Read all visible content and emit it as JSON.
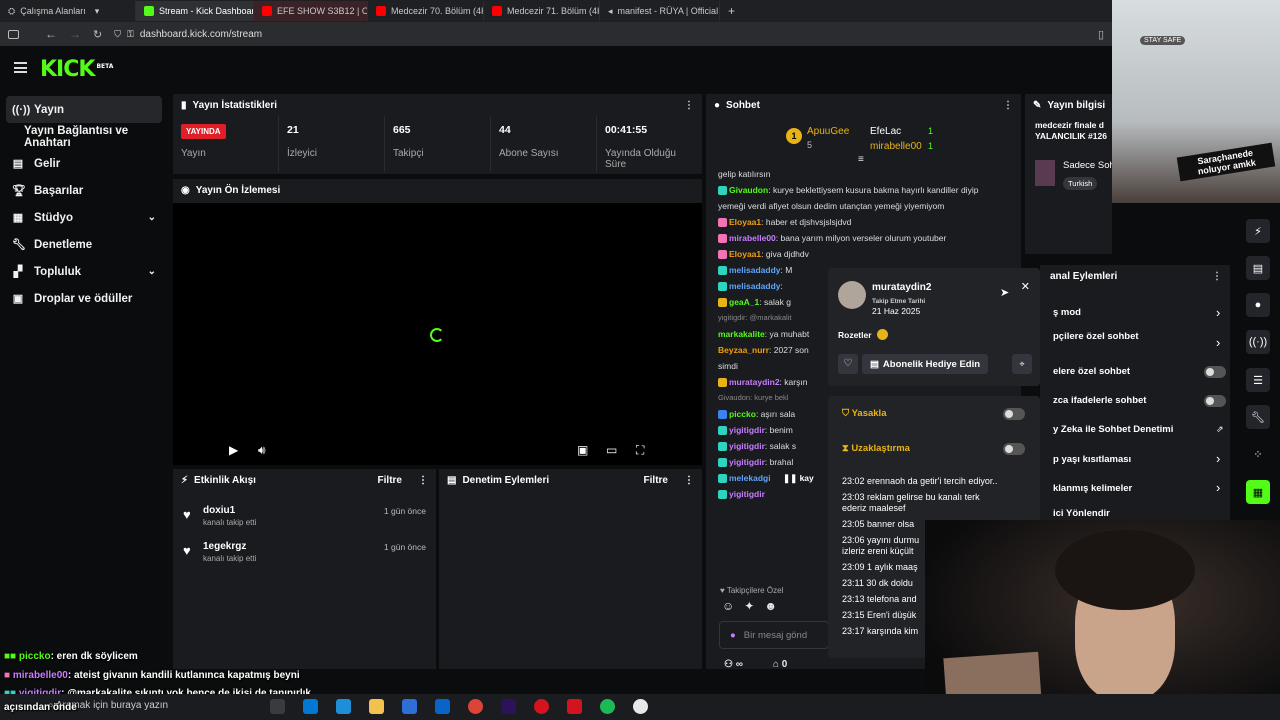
{
  "browser": {
    "tabs": [
      {
        "label": "Çalışma Alanları"
      },
      {
        "label": "Stream - Kick Dashboard"
      },
      {
        "label": "EFE SHOW S3B12 | ORKUN"
      },
      {
        "label": "Medcezir 70. Bölüm (4K) -"
      },
      {
        "label": "Medcezir 71. Bölüm (4K) -"
      },
      {
        "label": "manifest - RÜYA | Official M"
      }
    ],
    "new_tab": "+",
    "url": "dashboard.kick.com/stream"
  },
  "kick": {
    "logo": "KICK",
    "logo_badge": "BETA",
    "sidebar": [
      {
        "label": "Yayın",
        "icon": "broadcast-icon"
      },
      {
        "label": "Yayın Bağlantısı ve Anahtarı",
        "icon": ""
      },
      {
        "label": "Gelir",
        "icon": "revenue-icon"
      },
      {
        "label": "Başarılar",
        "icon": "trophy-icon"
      },
      {
        "label": "Stüdyo",
        "icon": "studio-icon"
      },
      {
        "label": "Denetleme",
        "icon": "wrench-icon"
      },
      {
        "label": "Topluluk",
        "icon": "community-icon"
      },
      {
        "label": "Droplar ve ödüller",
        "icon": "drops-icon"
      }
    ],
    "stats_panel": {
      "title": "Yayın İstatistikleri",
      "live_badge": "YAYINDA",
      "live_label": "Yayın",
      "items": [
        {
          "value": "21",
          "label": "İzleyici"
        },
        {
          "value": "665",
          "label": "Takipçi"
        },
        {
          "value": "44",
          "label": "Abone Sayısı"
        },
        {
          "value": "00:41:55",
          "label": "Yayında Olduğu Süre"
        }
      ]
    },
    "preview_title": "Yayın Ön İzlemesi",
    "activity": {
      "title": "Etkinlik Akışı",
      "filter": "Filtre",
      "items": [
        {
          "user": "doxiu1",
          "action": "kanalı takip etti",
          "time": "1 gün önce"
        },
        {
          "user": "1egekrgz",
          "action": "kanalı takip etti",
          "time": "1 gün önce"
        }
      ]
    },
    "mod_actions": {
      "title": "Denetim Eylemleri",
      "filter": "Filtre"
    },
    "chat": {
      "title": "Sohbet",
      "top_gifters": [
        {
          "name": "ApuuGee",
          "count": "5"
        },
        {
          "name": "EfeLac",
          "count": "1"
        },
        {
          "name": "mirabelle00",
          "count": "1"
        }
      ],
      "messages": [
        {
          "user": "",
          "text": "gelip katılırsın"
        },
        {
          "user": "Givaudon",
          "text": "kurye beklettiysem kusura bakma hayırlı kandiller diyip"
        },
        {
          "user": "",
          "text": "yemeği verdi afiyet olsun dedim utançtan yemeği yiyemiyom"
        },
        {
          "user": "Eloyaa1",
          "text": "haber et djshvsjslsjdvd"
        },
        {
          "user": "mirabelle00",
          "text": "bana yarım milyon verseler olurum youtuber"
        },
        {
          "user": "Eloyaa1",
          "text": "giva djdhdv"
        },
        {
          "user": "melisadaddy",
          "text": "M"
        },
        {
          "user": "melisadaddy",
          "text": ""
        },
        {
          "user": "geaA_1",
          "text": "salak g"
        },
        {
          "user": "",
          "text": "yigitigdir: @markakalit"
        },
        {
          "user": "markakalite",
          "text": "ya muhabt"
        },
        {
          "user": "Beyzaa_nurr",
          "text": "2027 son"
        },
        {
          "user": "",
          "text": "simdi"
        },
        {
          "user": "murataydin2",
          "text": "karşın"
        },
        {
          "user": "",
          "text": "Givaudon: kurye bekl"
        },
        {
          "user": "piccko",
          "text": "aşırı sala"
        },
        {
          "user": "yigitigdir",
          "text": "benim"
        },
        {
          "user": "yigitigdir",
          "text": "salak s"
        },
        {
          "user": "yigitigdir",
          "text": "brahal"
        },
        {
          "user": "melekadgi",
          "text": ""
        },
        {
          "user": "yigitigdir",
          "text": ""
        }
      ],
      "paused": "kay",
      "followers_only": "Takipçilere Özel",
      "input_placeholder": "Bir mesaj gönd",
      "bottom_left": "∞",
      "bottom_right": "0"
    },
    "user_card": {
      "username": "murataydin2",
      "follow_label": "Takip Etme Tarihi",
      "follow_date": "21 Haz 2025",
      "badges_label": "Rozetler",
      "gift_button": "Abonelik Hediye Edin",
      "ban_label": "Yasakla",
      "timeout_label": "Uzaklaştırma",
      "history": [
        {
          "time": "23:02",
          "text": "erennaoh da getir'i tercih ediyor.."
        },
        {
          "time": "23:03",
          "text": "reklam gelirse bu kanalı terk ederiz maalesef"
        },
        {
          "time": "23:05",
          "text": "banner olsa"
        },
        {
          "time": "23:06",
          "text": "yayını durmu izleriz ereni küçült"
        },
        {
          "time": "23:09",
          "text": "1 aylık maaş"
        },
        {
          "time": "23:11",
          "text": "30 dk doldu"
        },
        {
          "time": "23:13",
          "text": "telefona and"
        },
        {
          "time": "23:15",
          "text": "Eren'i düşük"
        },
        {
          "time": "23:17",
          "text": "karşında kim"
        }
      ]
    },
    "stream_info": {
      "title": "Yayın bilgisi",
      "stream_title": "medcezir finale d YALANCILIK #126",
      "category": "Sadece Soh",
      "language": "Turkish"
    },
    "channel_actions": {
      "title": "anal Eylemleri",
      "items": [
        {
          "label": "ş mod",
          "control": "arrow"
        },
        {
          "label": "pçilere özel sohbet",
          "control": "arrow"
        },
        {
          "label": "elere özel sohbet",
          "control": "toggle"
        },
        {
          "label": "zca ifadelerle sohbet",
          "control": "toggle"
        },
        {
          "label": "y Zeka ile Sohbet Denetimi",
          "control": "external"
        },
        {
          "label": "p yaşı kısıtlaması",
          "control": "arrow"
        },
        {
          "label": "klanmış kelimeler",
          "control": "arrow"
        },
        {
          "label": "ici Yönlendir",
          "control": "none"
        }
      ]
    }
  },
  "overlay": {
    "stay_safe": "STAY SAFE",
    "meme_text": "Saraçhanede noluyor amkk",
    "chat": [
      {
        "user": "piccko",
        "text": ": eren dk söylicem",
        "color": "#53fc18"
      },
      {
        "user": "mirabelle00",
        "text": ": ateist givanın kandili kutlanınca kapatmış beyni",
        "color": "#c77dff"
      },
      {
        "user": "yigitigdir",
        "text": ": @markakalite sıkıntı yok bence de ikisi de tanınırlık",
        "color": "#c77dff"
      }
    ],
    "taskbar_search": "Aramak için buraya yazın",
    "taskbar_overlap": "açısından önde"
  }
}
